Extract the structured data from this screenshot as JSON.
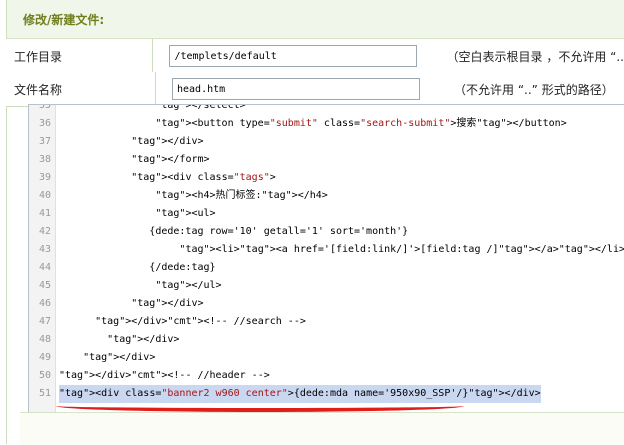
{
  "header": {
    "title": "修改/新建文件:"
  },
  "form": {
    "dir_label": "工作目录",
    "dir_value": "/templets/default",
    "dir_hint": "（空白表示根目录 ，不允许用 “..",
    "file_label": "文件名称",
    "file_value": "head.htm",
    "file_hint": "（不允许用 “..” 形式的路径）"
  },
  "editor": {
    "lines": [
      {
        "n": "35",
        "text": "                </select>"
      },
      {
        "n": "36",
        "text": "                <button type=\"submit\" class=\"search-submit\">搜索</button>"
      },
      {
        "n": "37",
        "text": "            </div>"
      },
      {
        "n": "38",
        "text": "            </form>"
      },
      {
        "n": "39",
        "text": "            <div class=\"tags\">"
      },
      {
        "n": "40",
        "text": "                <h4>热门标签:</h4>"
      },
      {
        "n": "41",
        "text": "                <ul>"
      },
      {
        "n": "42",
        "text": "               {dede:tag row='10' getall='1' sort='month'}"
      },
      {
        "n": "43",
        "text": "                    <li><a href='[field:link/]'>[field:tag /]</a></li>"
      },
      {
        "n": "44",
        "text": "               {/dede:tag}"
      },
      {
        "n": "45",
        "text": "                </ul>"
      },
      {
        "n": "46",
        "text": "            </div>"
      },
      {
        "n": "47",
        "text": "      </div><!-- //search -->"
      },
      {
        "n": "48",
        "text": "        </div>"
      },
      {
        "n": "49",
        "text": "    </div>"
      },
      {
        "n": "50",
        "text": "</div><!-- //header -->"
      },
      {
        "n": "51",
        "text": "<div class=\"banner2 w960 center\">{dede:mda name='950x90_SSP'/}</div>"
      }
    ]
  }
}
